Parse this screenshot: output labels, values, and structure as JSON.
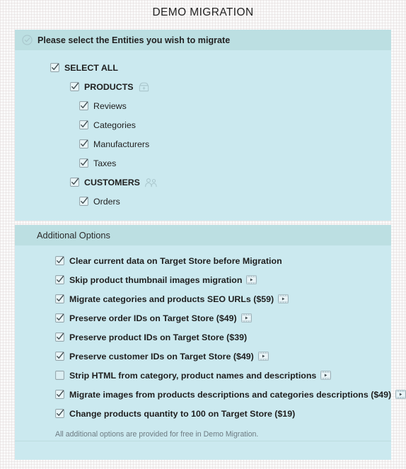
{
  "page": {
    "title": "DEMO MIGRATION",
    "accent_panel_bg": "#cbe9ef",
    "accent_header_bg": "#bcdfe2"
  },
  "entities_panel": {
    "header": {
      "icon": "circle-check-icon",
      "label": "Please select the Entities you wish to migrate"
    },
    "items": [
      {
        "label": "SELECT ALL",
        "checked": true,
        "level": 0,
        "bold": true,
        "icon": null
      },
      {
        "label": "PRODUCTS",
        "checked": true,
        "level": 1,
        "bold": true,
        "icon": "box-icon"
      },
      {
        "label": "Reviews",
        "checked": true,
        "level": 2,
        "bold": false,
        "icon": null
      },
      {
        "label": "Categories",
        "checked": true,
        "level": 2,
        "bold": false,
        "icon": null
      },
      {
        "label": "Manufacturers",
        "checked": true,
        "level": 2,
        "bold": false,
        "icon": null
      },
      {
        "label": "Taxes",
        "checked": true,
        "level": 2,
        "bold": false,
        "icon": null
      },
      {
        "label": "CUSTOMERS",
        "checked": true,
        "level": 1,
        "bold": true,
        "icon": "users-icon"
      },
      {
        "label": "Orders",
        "checked": true,
        "level": 2,
        "bold": false,
        "icon": null
      }
    ]
  },
  "options_panel": {
    "header": {
      "label": "Additional Options"
    },
    "options": [
      {
        "label": "Clear current data on Target Store before Migration",
        "checked": true,
        "icon": null
      },
      {
        "label": "Skip product thumbnail images migration",
        "checked": true,
        "icon": "film-icon"
      },
      {
        "label": "Migrate categories and products SEO URLs ($59)",
        "checked": true,
        "icon": "film-icon"
      },
      {
        "label": "Preserve order IDs on Target Store ($49)",
        "checked": true,
        "icon": "film-icon"
      },
      {
        "label": "Preserve product IDs on Target Store ($39)",
        "checked": true,
        "icon": null
      },
      {
        "label": "Preserve customer IDs on Target Store ($49)",
        "checked": true,
        "icon": "film-icon"
      },
      {
        "label": "Strip HTML from category, product names and descriptions",
        "checked": false,
        "icon": "film-icon"
      },
      {
        "label": "Migrate images from products descriptions and categories descriptions ($49)",
        "checked": true,
        "icon": "film-icon"
      },
      {
        "label": "Change products quantity to 100 on Target Store ($19)",
        "checked": true,
        "icon": null
      }
    ],
    "note": "All additional options are provided for free in Demo Migration."
  }
}
